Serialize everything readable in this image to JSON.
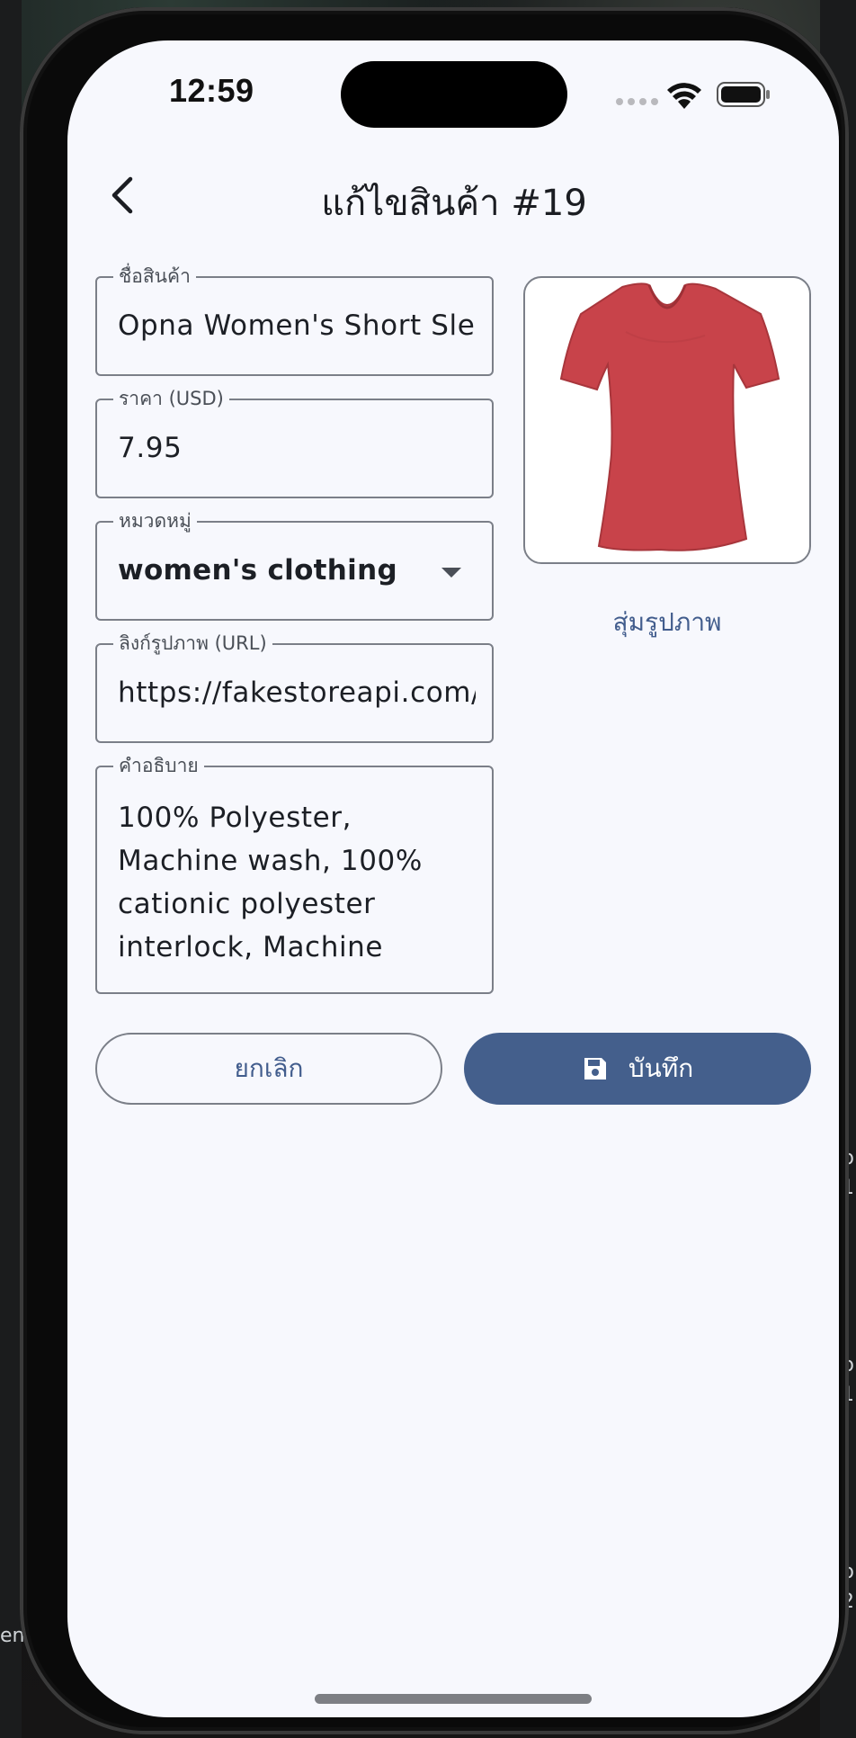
{
  "status_bar": {
    "time": "12:59"
  },
  "header": {
    "title": "แก้ไขสินค้า #19"
  },
  "form": {
    "name": {
      "label": "ชื่อสินค้า",
      "value": "Opna Women's Short Sle"
    },
    "price": {
      "label": "ราคา (USD)",
      "value": "7.95"
    },
    "category": {
      "label": "หมวดหมู่",
      "value": "women's clothing"
    },
    "image_url": {
      "label": "ลิงก์รูปภาพ (URL)",
      "value": "https://fakestoreapi.com/"
    },
    "description": {
      "label": "คำอธิบาย",
      "value": "100% Polyester, Machine wash, 100% cationic polyester interlock, Machine"
    }
  },
  "image_panel": {
    "random_button": "สุ่มรูปภาพ",
    "product_color": "#c8434a"
  },
  "actions": {
    "cancel": "ยกเลิก",
    "save": "บันทึก"
  },
  "icons": {
    "back": "chevron-left-icon",
    "save": "floppy-disk-icon",
    "dropdown": "triangle-down-icon"
  },
  "colors": {
    "accent": "#445f8c",
    "background": "#f7f8fd",
    "border": "#7b7f88"
  },
  "desktop_fragments": {
    "right": [
      "o",
      "1",
      "o",
      "1",
      "o",
      "2"
    ],
    "left": [
      "en"
    ]
  }
}
